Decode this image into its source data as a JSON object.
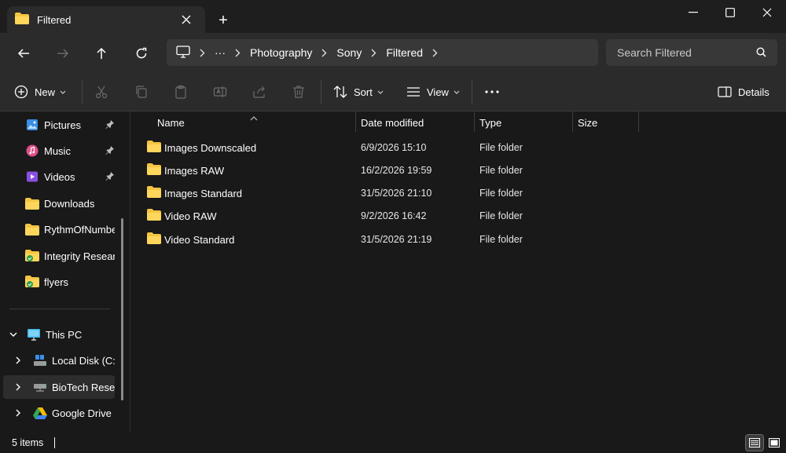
{
  "window": {
    "tab_title": "Filtered",
    "new_tab_label": "+"
  },
  "nav": {
    "breadcrumbs": [
      "Photography",
      "Sony",
      "Filtered"
    ],
    "overflow_label": "···",
    "search_placeholder": "Search Filtered"
  },
  "commands": {
    "new_label": "New",
    "sort_label": "Sort",
    "view_label": "View",
    "more_label": "···",
    "details_label": "Details"
  },
  "sidebar": {
    "quick_access": [
      {
        "label": "Pictures",
        "icon": "pictures-icon",
        "pinned": true
      },
      {
        "label": "Music",
        "icon": "music-icon",
        "pinned": true
      },
      {
        "label": "Videos",
        "icon": "videos-icon",
        "pinned": true
      },
      {
        "label": "Downloads",
        "icon": "folder-icon",
        "pinned": false
      },
      {
        "label": "RythmOfNumbers",
        "icon": "folder-icon",
        "pinned": false
      },
      {
        "label": "Integrity Research",
        "icon": "shared-folder-icon",
        "pinned": false
      },
      {
        "label": "flyers",
        "icon": "shared-folder-icon",
        "pinned": false
      }
    ],
    "this_pc_label": "This PC",
    "drives": [
      {
        "label": "Local Disk (C:)",
        "icon": "local-disk-icon"
      },
      {
        "label": "BioTech Research",
        "icon": "network-drive-icon"
      },
      {
        "label": "Google Drive (G:)",
        "icon": "google-drive-icon"
      }
    ]
  },
  "columns": {
    "name": "Name",
    "date": "Date modified",
    "type": "Type",
    "size": "Size"
  },
  "files": [
    {
      "name": "Images Downscaled",
      "date": "6/9/2026 15:10",
      "type": "File folder"
    },
    {
      "name": "Images RAW",
      "date": "16/2/2026 19:59",
      "type": "File folder"
    },
    {
      "name": "Images Standard",
      "date": "31/5/2026 21:10",
      "type": "File folder"
    },
    {
      "name": "Video RAW",
      "date": "9/2/2026 16:42",
      "type": "File folder"
    },
    {
      "name": "Video Standard",
      "date": "31/5/2026 21:19",
      "type": "File folder"
    }
  ],
  "status": {
    "item_count": "5 items"
  },
  "colors": {
    "folder": "#f4c542",
    "background": "#191919",
    "toolbar": "#2b2b2b"
  }
}
